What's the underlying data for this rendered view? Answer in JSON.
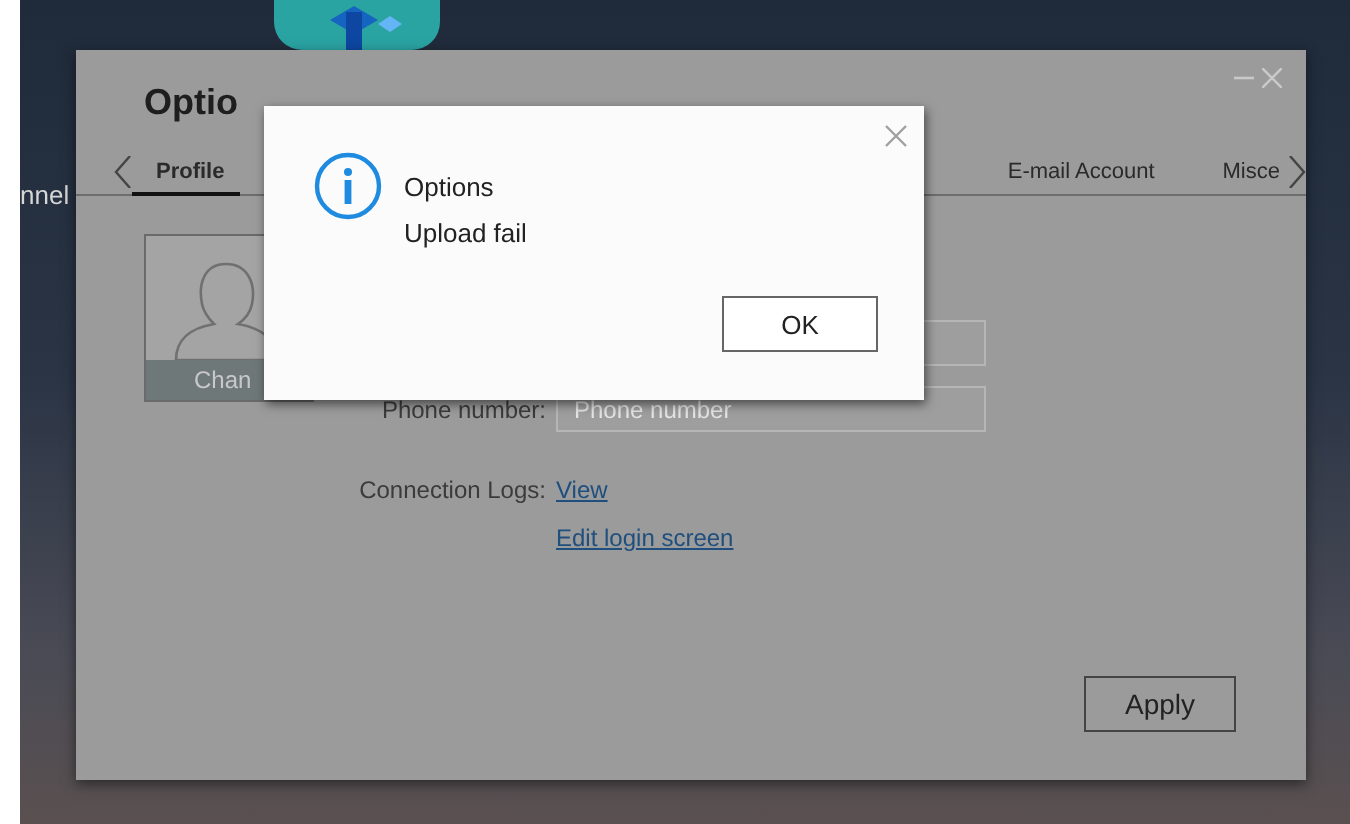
{
  "desktop": {
    "label": "nnel"
  },
  "window": {
    "title": "Optio",
    "tabs": [
      {
        "label": "Profile",
        "selected": true
      },
      {
        "label": "E-mail Account",
        "selected": false
      },
      {
        "label": "Misce",
        "selected": false
      }
    ],
    "avatar": {
      "caption": "Chan"
    },
    "fields": [
      {
        "kind": "blank"
      },
      {
        "kind": "labeled",
        "label": "Phone number:",
        "placeholder": "Phone number"
      }
    ],
    "connection_logs": {
      "label": "Connection Logs:",
      "link": "View"
    },
    "edit_login_link": "Edit login screen",
    "apply_button": "Apply"
  },
  "dialog": {
    "title": "Options",
    "message": "Upload fail",
    "ok_button": "OK"
  }
}
